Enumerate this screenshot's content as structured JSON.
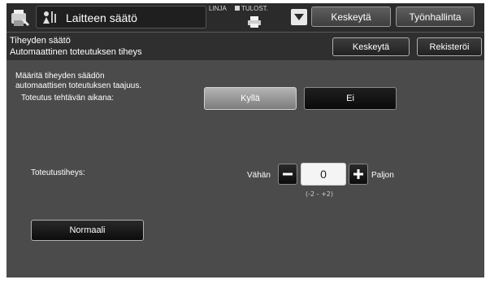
{
  "topbar": {
    "title": "Laitteen säätö",
    "indicator_line": "LINJA",
    "indicator_print": "TULOST.",
    "pause_label": "Keskeytä",
    "job_status_label": "Työnhallinta"
  },
  "subheader": {
    "line1": "Tiheyden säätö",
    "line2": "Automaattinen toteutuksen tiheys",
    "pause_label": "Keskeytä",
    "register_label": "Rekisteröi"
  },
  "main": {
    "description_line1": "Määritä tiheyden säädön",
    "description_line2": "automaattisen toteutuksen taajuus.",
    "execution_label": "Toteutus tehtävän aikana:",
    "yes_label": "Kyllä",
    "no_label": "Ei",
    "selected_option": "Kyllä",
    "level_label": "Toteutustiheys:",
    "less_label": "Vähän",
    "more_label": "Paljon",
    "value": "0",
    "range": "(-2 - +2)",
    "normal_label": "Normaali"
  }
}
